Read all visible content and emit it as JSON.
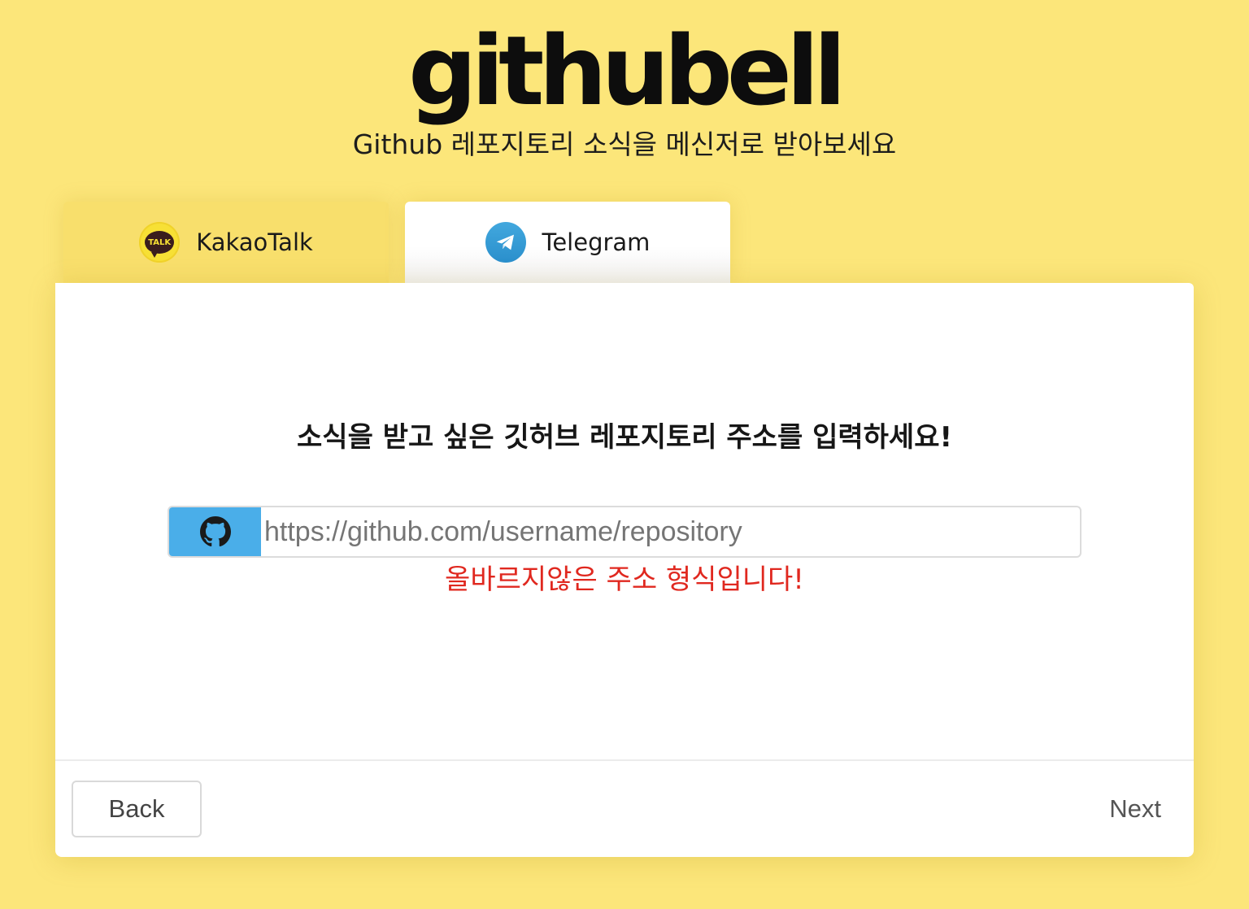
{
  "header": {
    "logo_text": "githubell",
    "subtitle": "Github 레포지토리 소식을 메신저로 받아보세요"
  },
  "tabs": [
    {
      "label": "KakaoTalk",
      "icon": "kakaotalk-icon",
      "icon_text": "TALK",
      "active": false
    },
    {
      "label": "Telegram",
      "icon": "telegram-icon",
      "active": true
    }
  ],
  "form": {
    "prompt": "소식을 받고 싶은 깃허브 레포지토리 주소를 입력하세요!",
    "repo_input": {
      "value": "",
      "placeholder": "https://github.com/username/repository",
      "addon_icon": "github-icon"
    },
    "error": "올바르지않은 주소 형식입니다!"
  },
  "footer": {
    "back_label": "Back",
    "next_label": "Next"
  },
  "colors": {
    "background": "#fce67a",
    "addon": "#4aaee9",
    "error": "#e0281f",
    "telegram": "#2a8fcc",
    "kakao": "#f7e035"
  }
}
